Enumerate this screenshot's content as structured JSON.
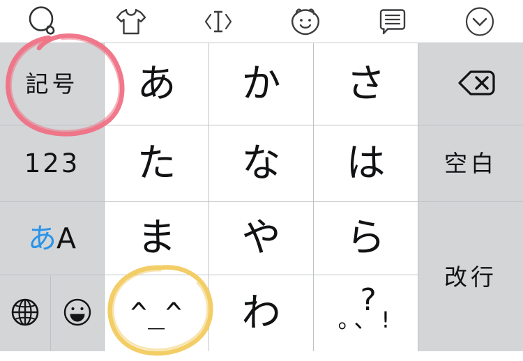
{
  "toolbar": {
    "items": [
      {
        "icon": "search-icon",
        "label": "検索"
      },
      {
        "icon": "tshirt-icon",
        "label": "着せ替え"
      },
      {
        "icon": "cursor-move-icon",
        "label": "カーソル移動"
      },
      {
        "icon": "bear-face-icon",
        "label": "顔文字"
      },
      {
        "icon": "speech-bubble-icon",
        "label": "定型文"
      },
      {
        "icon": "chevron-down-circle-icon",
        "label": "キーボードを閉じる"
      }
    ]
  },
  "keyboard": {
    "rows": [
      {
        "keys": [
          {
            "name": "symbols-key",
            "label": "記号",
            "style": "side",
            "type": "jp"
          },
          {
            "name": "key-a",
            "label": "あ",
            "style": "center",
            "type": "kana"
          },
          {
            "name": "key-ka",
            "label": "か",
            "style": "center",
            "type": "kana"
          },
          {
            "name": "key-sa",
            "label": "さ",
            "style": "center",
            "type": "kana"
          },
          {
            "name": "backspace-key",
            "label": "",
            "style": "side",
            "type": "icon",
            "icon": "backspace-icon"
          }
        ]
      },
      {
        "keys": [
          {
            "name": "numbers-key",
            "label": "123",
            "style": "side",
            "type": "num"
          },
          {
            "name": "key-ta",
            "label": "た",
            "style": "center",
            "type": "kana"
          },
          {
            "name": "key-na",
            "label": "な",
            "style": "center",
            "type": "kana"
          },
          {
            "name": "key-ha",
            "label": "は",
            "style": "center",
            "type": "kana"
          },
          {
            "name": "space-key",
            "label": "空白",
            "style": "side",
            "type": "jp"
          }
        ]
      },
      {
        "keys": [
          {
            "name": "input-mode-key",
            "label_jp": "あ",
            "label_en": "A",
            "style": "side",
            "type": "aa"
          },
          {
            "name": "key-ma",
            "label": "ま",
            "style": "center",
            "type": "kana"
          },
          {
            "name": "key-ya",
            "label": "や",
            "style": "center",
            "type": "kana"
          },
          {
            "name": "key-ra",
            "label": "ら",
            "style": "center",
            "type": "kana"
          },
          {
            "name": "return-key",
            "label": "改行",
            "style": "side",
            "type": "jp"
          }
        ]
      },
      {
        "keys": [
          {
            "name": "globe-key",
            "label": "",
            "style": "side",
            "type": "icon",
            "icon": "globe-icon"
          },
          {
            "name": "emoji-key",
            "label": "",
            "style": "side",
            "type": "icon",
            "icon": "smiley-face-icon"
          },
          {
            "name": "kaomoji-key",
            "label": "^_^",
            "style": "center",
            "type": "kaomoji"
          },
          {
            "name": "key-wa",
            "label": "わ",
            "style": "center",
            "type": "kana"
          },
          {
            "name": "punctuation-key",
            "label": "?",
            "label_sub": "。、!",
            "style": "center",
            "type": "punct"
          }
        ]
      }
    ]
  },
  "annotations": [
    {
      "name": "red-circle-annotation",
      "target": "記号",
      "color": "#ef7184"
    },
    {
      "name": "yellow-circle-annotation",
      "target": "^_^",
      "color": "#f2ca5e"
    }
  ],
  "colors": {
    "side_key_bg": "#d3d5d7",
    "center_key_bg": "#ffffff",
    "key_border": "#bfc2c5",
    "text": "#111214",
    "accent_blue": "#2a93e8",
    "annotation_red": "#ef7184",
    "annotation_yellow": "#f2ca5e"
  }
}
